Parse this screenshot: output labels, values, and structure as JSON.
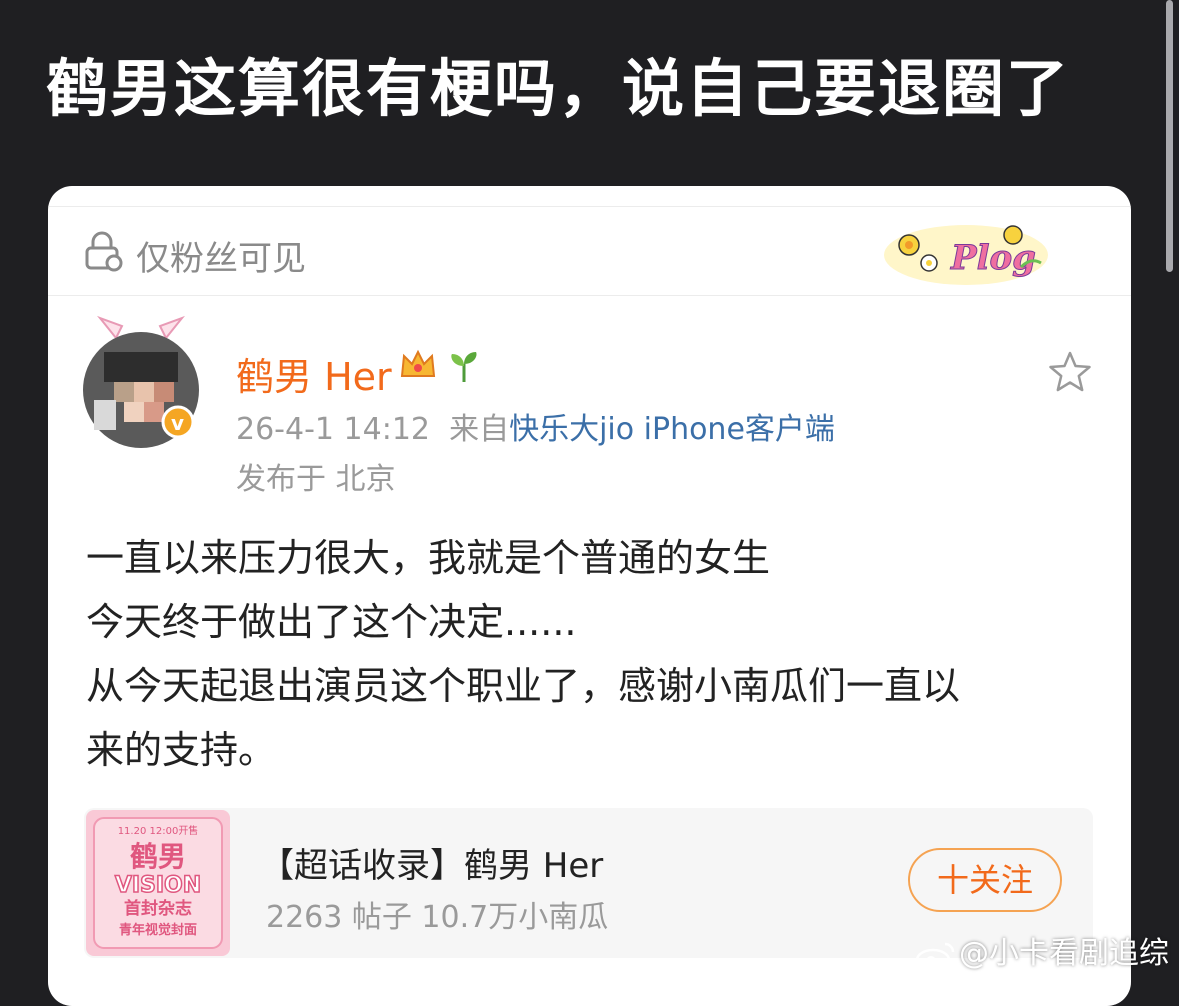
{
  "headline": "鹤男这算很有梗吗，说自己要退圈了",
  "visibility": {
    "label": "仅粉丝可见",
    "icon": "lock-icon",
    "decoration_text": "Plog"
  },
  "post": {
    "author": "鹤男 Her",
    "timestamp": "26-4-1 14:12",
    "source_prefix": "来自",
    "source": "快乐大jio iPhone客户端",
    "location": "发布于 北京",
    "lines": [
      "一直以来压力很大，我就是个普通的女生",
      "今天终于做出了这个决定......",
      "从今天起退出演员这个职业了，感谢小南瓜们一直以",
      "来的支持。"
    ]
  },
  "topic": {
    "title": "【超话收录】鹤男 Her",
    "stats": "2263 帖子  10.7万小南瓜",
    "follow_label": "十关注",
    "thumb_lines": [
      "11.20 12:00开售",
      "鹤男",
      "VISION",
      "首封杂志",
      "青年视觉封面"
    ]
  },
  "watermark": "@小卡看剧追综",
  "colors": {
    "accent": "#f26a1b",
    "link": "#3b6fa8",
    "background": "#1f1f22"
  }
}
